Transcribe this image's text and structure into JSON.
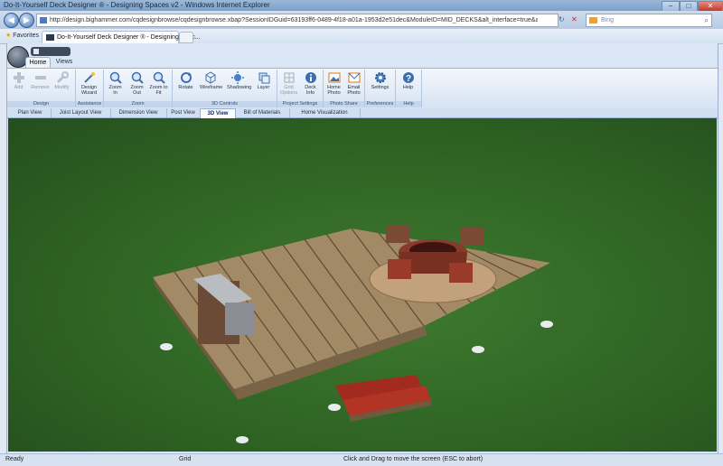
{
  "window": {
    "title": "Do-It-Yourself Deck Designer ® - Designing Spaces v2 - Windows Internet Explorer",
    "min": "–",
    "max": "□",
    "close": "✕"
  },
  "browser": {
    "url": "http://design.bighammer.com/cqdesignbrowse/cqdesignbrowse.xbap?SessionIDGuid=63193ff6-0489-4f18-a01a-1953d2e51dec&ModuleID=MID_DECKS&alt_interface=true&alt_iconstrue&diagsfalse&WebSvc=h",
    "search_placeholder": "Bing",
    "favorites_label": "Favorites",
    "tab_title": "Do-It-Yourself Deck Designer ® - Designing Spac..."
  },
  "ribbon": {
    "tabs": [
      "Home",
      "Views"
    ],
    "groups": [
      {
        "label": "Design",
        "buttons": [
          "Add",
          "Remove",
          "Modify"
        ]
      },
      {
        "label": "Assistance",
        "buttons": [
          "Design\nWizard"
        ]
      },
      {
        "label": "Zoom",
        "buttons": [
          "Zoom\nIn",
          "Zoom\nOut",
          "Zoom to\nFit"
        ]
      },
      {
        "label": "3D Controls",
        "buttons": [
          "Rotate",
          "Wireframe",
          "Shadowing",
          "Layer"
        ]
      },
      {
        "label": "Project Settings",
        "buttons": [
          "Grid\nOptions",
          "Deck\nInfo"
        ]
      },
      {
        "label": "Photo Share",
        "buttons": [
          "Home\nPhoto",
          "Email\nPhoto"
        ]
      },
      {
        "label": "Preferences",
        "buttons": [
          "Settings"
        ]
      },
      {
        "label": "Help",
        "buttons": [
          "Help"
        ]
      }
    ]
  },
  "view_tabs": [
    "Plan View",
    "Joist Layout View",
    "Dimension View",
    "Post View",
    "3D View",
    "Bill of Materials",
    "Home Visualization"
  ],
  "active_view": "3D View",
  "status": {
    "left": "Ready",
    "grid": "Grid",
    "hint": "Click and Drag to move the screen  (ESC to abort)"
  }
}
